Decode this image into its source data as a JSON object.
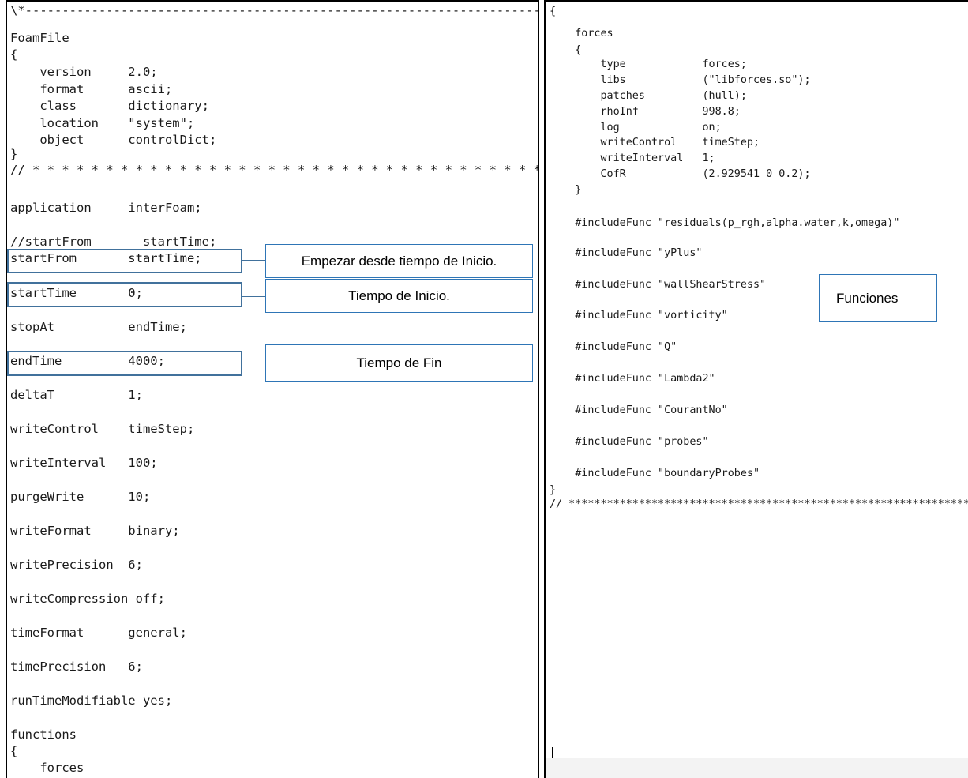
{
  "left_code": {
    "l01": "\\*-----------------------------------------------------------------------",
    "l02": "FoamFile",
    "l03": "{",
    "l04": "    version     2.0;",
    "l05": "    format      ascii;",
    "l06": "    class       dictionary;",
    "l07": "    location    \"system\";",
    "l08": "    object      controlDict;",
    "l09": "}",
    "l10": "// * * * * * * * * * * * * * * * * * * * * * * * * * * * * * * * * * * * * *",
    "l11": "application     interFoam;",
    "l12": "//startFrom       startTime;",
    "l13": "startFrom       startTime;",
    "l14": "startTime       0;",
    "l15": "stopAt          endTime;",
    "l16": "endTime         4000;",
    "l17": "deltaT          1;",
    "l18": "writeControl    timeStep;",
    "l19": "writeInterval   100;",
    "l20": "purgeWrite      10;",
    "l21": "writeFormat     binary;",
    "l22": "writePrecision  6;",
    "l23": "writeCompression off;",
    "l24": "timeFormat      general;",
    "l25": "timePrecision   6;",
    "l26": "runTimeModifiable yes;",
    "l27": "functions",
    "l28": "{",
    "l29": "    forces"
  },
  "right_code": {
    "r01": "{",
    "r02": "    forces",
    "r03": "    {",
    "r04": "        type            forces;",
    "r05": "        libs            (\"libforces.so\");",
    "r06": "        patches         (hull);",
    "r07": "        rhoInf          998.8;",
    "r08": "        log             on;",
    "r09": "        writeControl    timeStep;",
    "r10": "        writeInterval   1;",
    "r11": "        CofR            (2.929541 0 0.2);",
    "r12": "    }",
    "r13": "    #includeFunc \"residuals(p_rgh,alpha.water,k,omega)\"",
    "r14": "    #includeFunc \"yPlus\"",
    "r15": "    #includeFunc \"wallShearStress\"",
    "r16": "    #includeFunc \"vorticity\"",
    "r17": "    #includeFunc \"Q\"",
    "r18": "    #includeFunc \"Lambda2\"",
    "r19": "    #includeFunc \"CourantNo\"",
    "r20": "    #includeFunc \"probes\"",
    "r21": "    #includeFunc \"boundaryProbes\"",
    "r22": "}",
    "r23": "// ****************************************************************************"
  },
  "callouts": {
    "start_from": "Empezar desde tiempo de Inicio.",
    "start_time": "Tiempo de Inicio.",
    "end_time": "Tiempo de Fin",
    "functions": "Funciones"
  },
  "colors": {
    "highlight_border": "#41719c",
    "callout_border": "#2e75b6"
  }
}
